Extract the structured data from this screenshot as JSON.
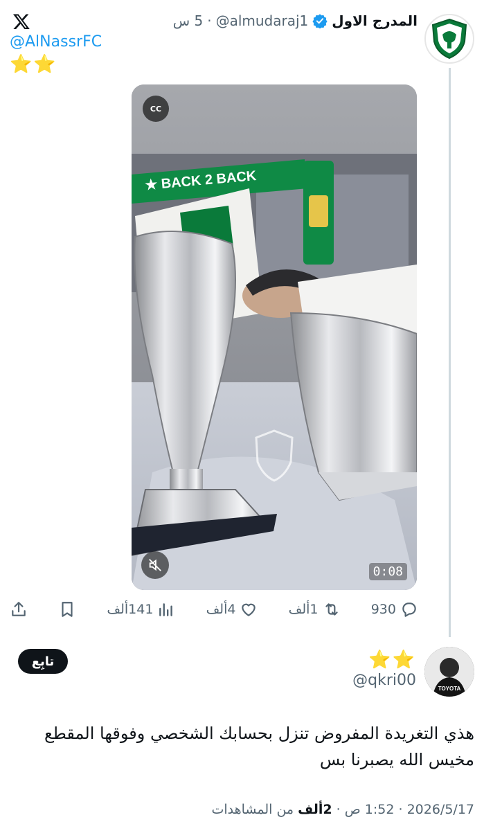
{
  "tweet": {
    "display_name": "المدرج الاول",
    "username": "@almudaraj1",
    "separator": "·",
    "time": "5 س",
    "mention": "@AlNassrFC",
    "stars": "⭐⭐",
    "media": {
      "cc_label": "CC",
      "duration": "0:08",
      "scarf_text": "BACK 2 BACK"
    },
    "actions": {
      "replies": "930",
      "retweets": "1ألف",
      "likes": "4ألف",
      "views": "141ألف"
    }
  },
  "reply": {
    "stars": "⭐⭐",
    "username": "@qkri00",
    "follow_label": "تابِع",
    "avatar_text": "TOYOTA",
    "text_line1": "هذي التغريدة المفروض تنزل بحسابك الشخصي وفوقها المقطع",
    "text_line2": "مخيس الله يصبرنا بس",
    "meta_date": "2026/5/17 · 1:52 ص · ",
    "meta_views_count": "2ألف",
    "meta_views_label": " من المشاهدات"
  },
  "colors": {
    "link": "#1d9bf0",
    "verified": "#1d9bf0",
    "muted_text": "#536471",
    "club_green": "#0a7a3a"
  },
  "icons": [
    "x-logo-icon",
    "verified-badge-icon",
    "cc-icon",
    "mute-icon",
    "reply-icon",
    "retweet-icon",
    "like-icon",
    "views-icon",
    "bookmark-icon",
    "share-icon"
  ]
}
